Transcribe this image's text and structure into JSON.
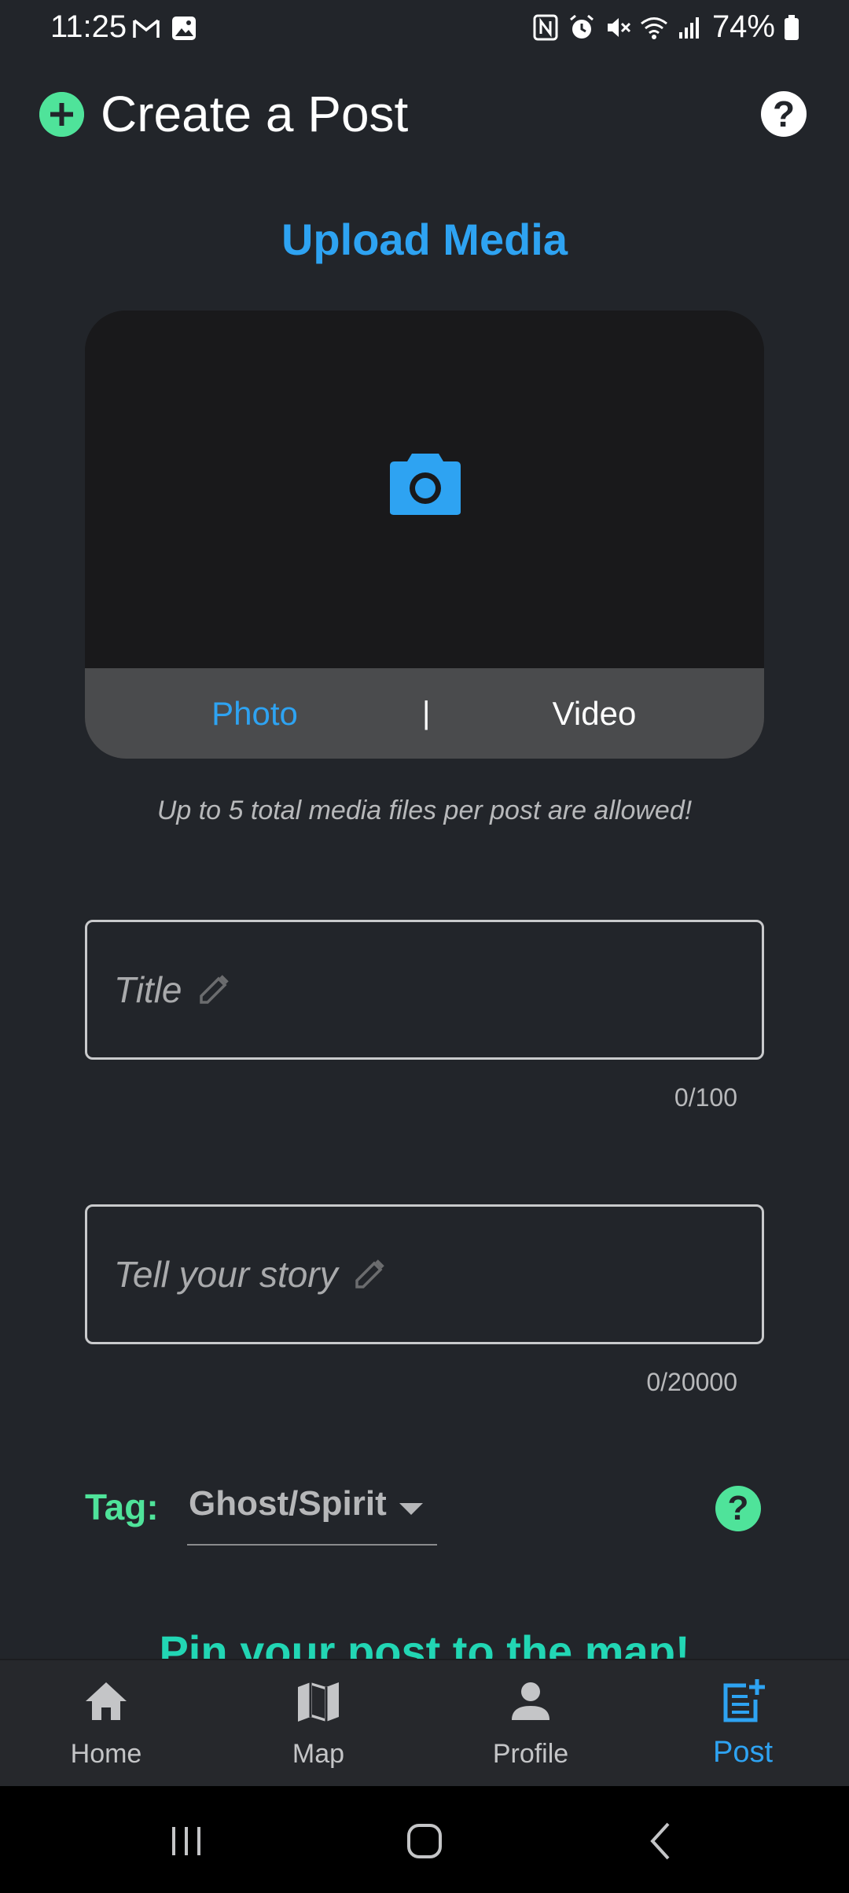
{
  "status": {
    "time": "11:25",
    "battery": "74%"
  },
  "header": {
    "title": "Create a Post",
    "help": "?"
  },
  "upload": {
    "heading": "Upload Media",
    "tabs": {
      "photo": "Photo",
      "divider": "|",
      "video": "Video"
    },
    "note": "Up to 5 total media files per post are allowed!"
  },
  "form": {
    "title": {
      "placeholder": "Title",
      "counter": "0/100"
    },
    "story": {
      "placeholder": "Tell your story",
      "counter": "0/20000"
    }
  },
  "tag": {
    "label": "Tag:",
    "value": "Ghost/Spirit",
    "help": "?"
  },
  "pin": {
    "heading": "Pin your post to the map!"
  },
  "nav": {
    "items": [
      {
        "label": "Home",
        "icon": "home-icon"
      },
      {
        "label": "Map",
        "icon": "map-icon"
      },
      {
        "label": "Profile",
        "icon": "person-icon"
      },
      {
        "label": "Post",
        "icon": "post-add-icon",
        "active": true
      }
    ]
  },
  "colors": {
    "accent_blue": "#2ea3f2",
    "accent_green": "#4fe39a",
    "accent_teal": "#22d6b4",
    "background": "#22252a"
  }
}
